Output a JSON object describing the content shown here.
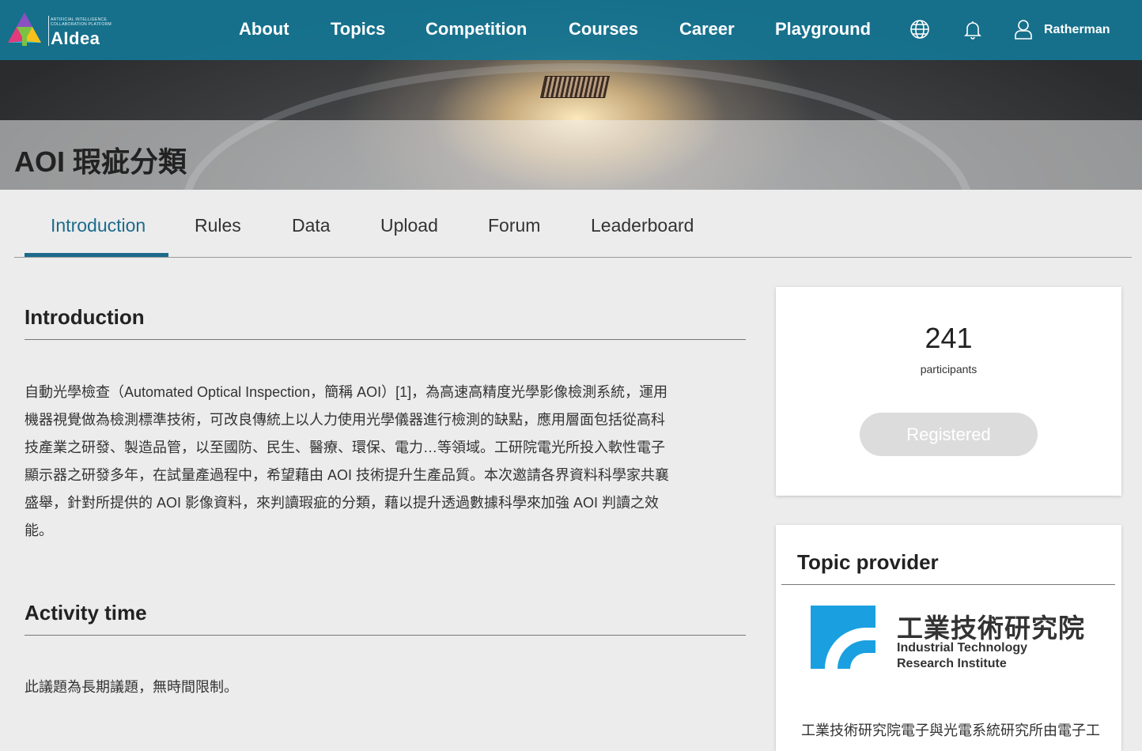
{
  "header": {
    "logo_small_line1": "ARTIFICIAL INTELLIGENCE",
    "logo_small_line2": "COLLABORATION PLATFORM",
    "logo_text": "AIdea",
    "nav": [
      "About",
      "Topics",
      "Competition",
      "Courses",
      "Career",
      "Playground"
    ],
    "icons": [
      "globe-icon",
      "bell-icon",
      "user-icon"
    ],
    "username": "Ratherman"
  },
  "page": {
    "title": "AOI 瑕疵分類"
  },
  "tabs": {
    "items": [
      "Introduction",
      "Rules",
      "Data",
      "Upload",
      "Forum",
      "Leaderboard"
    ],
    "active": "Introduction"
  },
  "main": {
    "intro_heading": "Introduction",
    "intro_lines": [
      "自動光學檢查（Automated Optical Inspection，簡稱 AOI）[1]，為高速高精度光學影像檢測系統，運用",
      "機器視覺做為檢測標準技術，可改良傳統上以人力使用光學儀器進行檢測的缺點，應用層面包括從高科",
      "技產業之研發、製造品管，以至國防、民生、醫療、環保、電力…等領域。工研院電光所投入軟性電子",
      "顯示器之研發多年，在試量產過程中，希望藉由 AOI 技術提升生產品質。本次邀請各界資料科學家共襄",
      "盛舉，針對所提供的 AOI 影像資料，來判讀瑕疵的分類，藉以提升透過數據科學來加強 AOI 判讀之效",
      "能。"
    ],
    "activity_heading": "Activity time",
    "activity_text": "此議題為長期議題，無時間限制。"
  },
  "sidebar": {
    "participants_count": "241",
    "participants_label": "participants",
    "register_label": "Registered",
    "provider_heading": "Topic provider",
    "provider_name_cn": "工業技術研究院",
    "provider_name_en_1": "Industrial Technology",
    "provider_name_en_2": "Research Institute",
    "provider_text": "工業技術研究院電子與光電系統研究所由電子工"
  },
  "colors": {
    "nav_bg": "#1478a0",
    "accent": "#1d6b8c",
    "button_disabled": "#dcdcdc",
    "page_bg": "#ececec",
    "itri_blue": "#1aa0e0"
  }
}
